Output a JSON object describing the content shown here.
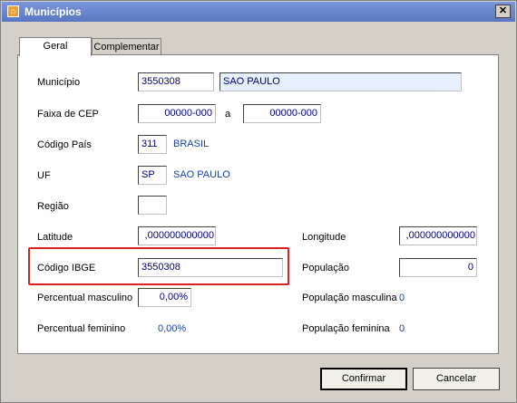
{
  "window": {
    "title": "Municípios",
    "close_glyph": "✕"
  },
  "tabs": [
    {
      "label": "Geral"
    },
    {
      "label": "Complementar"
    }
  ],
  "form": {
    "municipio": {
      "label": "Município",
      "code": "3550308",
      "name": "SAO PAULO"
    },
    "faixa_cep": {
      "label": "Faixa de CEP",
      "from": "00000-000",
      "separator": "a",
      "to": "00000-000"
    },
    "codigo_pais": {
      "label": "Código País",
      "code": "311",
      "name": "BRASIL"
    },
    "uf": {
      "label": "UF",
      "code": "SP",
      "name": "SAO PAULO"
    },
    "regiao": {
      "label": "Região",
      "value": ""
    },
    "latitude": {
      "label": "Latitude",
      "value": ",000000000000"
    },
    "longitude": {
      "label": "Longitude",
      "value": ",000000000000"
    },
    "codigo_ibge": {
      "label": "Código IBGE",
      "value": "3550308"
    },
    "populacao": {
      "label": "População",
      "value": "0"
    },
    "percentual_masculino": {
      "label": "Percentual masculino",
      "value": "0,00%"
    },
    "populacao_masculina": {
      "label": "População masculina",
      "value": "0"
    },
    "percentual_feminino": {
      "label": "Percentual feminino",
      "value": "0,00%"
    },
    "populacao_feminina": {
      "label": "População feminina",
      "value": "0"
    }
  },
  "buttons": {
    "confirm": "Confirmar",
    "cancel": "Cancelar"
  },
  "colors": {
    "highlight": "#e02020",
    "value_text": "#1a3ea8",
    "titlebar": "#5a76c0"
  }
}
